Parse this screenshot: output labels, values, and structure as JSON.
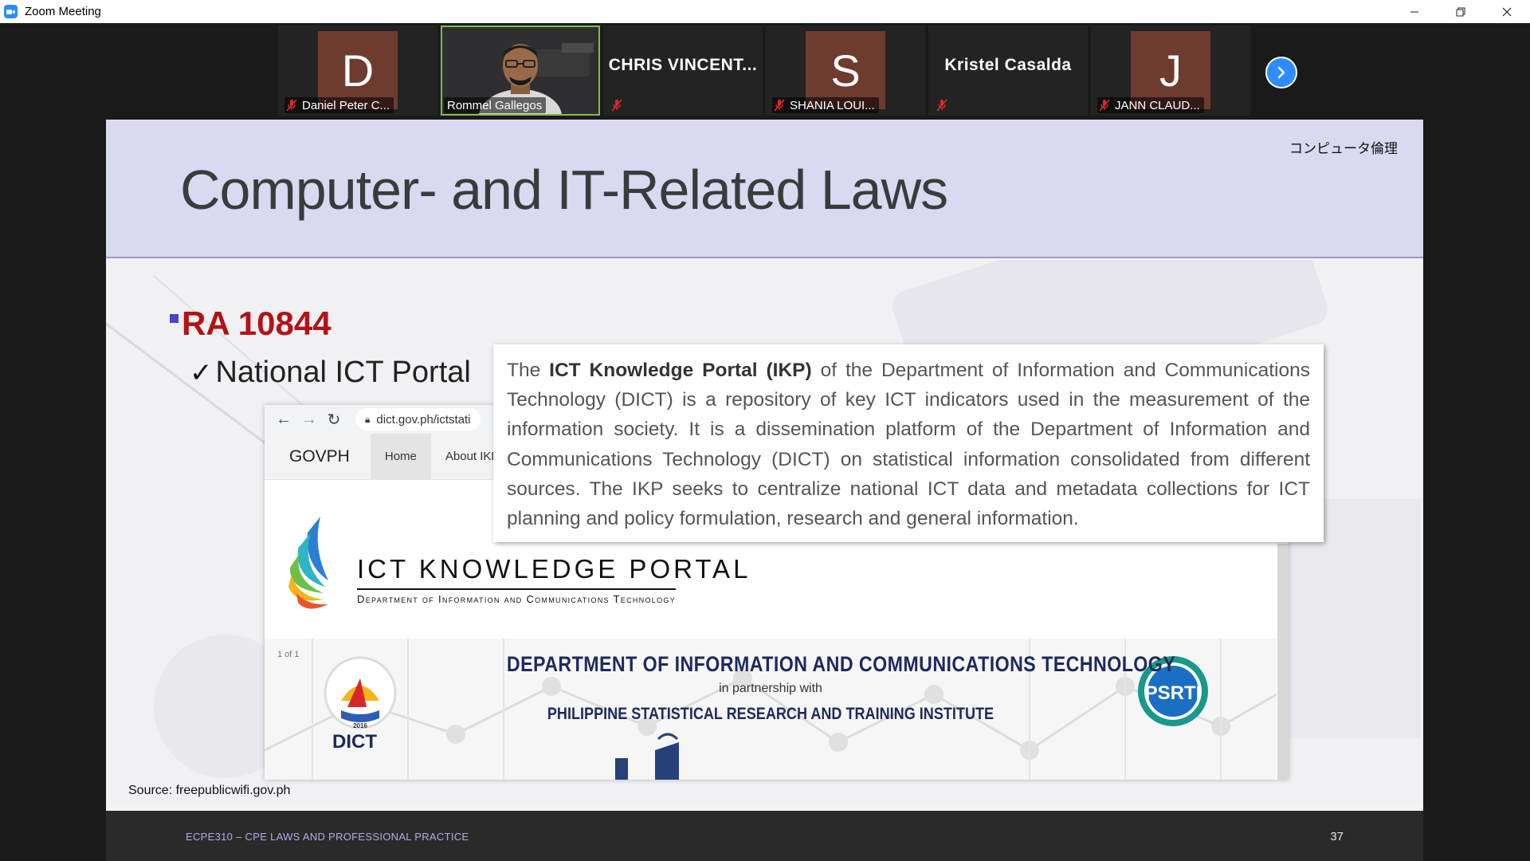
{
  "window": {
    "title": "Zoom Meeting",
    "controls": [
      "minimize",
      "restore",
      "close"
    ]
  },
  "participants": [
    {
      "initial": "D",
      "name": "Daniel Peter C...",
      "muted": true,
      "type": "avatar"
    },
    {
      "initial": "",
      "name": "Rommel Gallegos",
      "muted": false,
      "type": "video",
      "active_speaker": true
    },
    {
      "initial": "",
      "name": "CHRIS  VINCENT...",
      "muted": true,
      "type": "name-only"
    },
    {
      "initial": "S",
      "name": "SHANIA LOUI...",
      "muted": true,
      "type": "avatar"
    },
    {
      "initial": "",
      "name": "Kristel Casalda",
      "muted": true,
      "type": "name-only"
    },
    {
      "initial": "J",
      "name": "JANN CLAUD...",
      "muted": true,
      "type": "avatar"
    }
  ],
  "slide": {
    "jp_label": "コンピュータ倫理",
    "title": "Computer- and IT-Related Laws",
    "bullet": "RA 10844",
    "check_item": "National ICT Portal",
    "source": "Source: freepublicwifi.gov.ph",
    "footer": "ECPE310 – CPE LAWS AND PROFESSIONAL PRACTICE",
    "page_number": "37",
    "callout": {
      "pre": "The ",
      "bold": "ICT Knowledge Portal (IKP)",
      "post": " of the Department of Information and Communications Technology (DICT) is a repository of key ICT indicators used in the measurement of the information society. It is a dissemination platform of the Department of Information and Communications Technology (DICT) on statistical information consolidated from different sources. The IKP seeks to centralize national ICT data and metadata collections for ICT planning and policy formulation, research and general information."
    },
    "website": {
      "url": "dict.gov.ph/ictstati",
      "nav": {
        "brand": "GOVPH",
        "items": [
          "Home",
          "About IKP"
        ]
      },
      "portal_name": "ICT KNOWLEDGE PORTAL",
      "portal_subtitle": "Department of Information and Communications Technology",
      "banner_line1": "DEPARTMENT OF INFORMATION AND COMMUNICATIONS TECHNOLOGY",
      "banner_line2": "in partnership with",
      "banner_line3": "PHILIPPINE STATISTICAL RESEARCH AND TRAINING INSTITUTE",
      "dict_logo_text": "DICT",
      "dict_seal_year": "2016",
      "psrti_logo_text": "PSRTI",
      "pager": "1 of 1"
    }
  },
  "colors": {
    "zoom_blue": "#2d8cff",
    "avatar_brown": "#6e3b2f",
    "slide_header": "#d9d9f1",
    "bullet_red": "#b31217",
    "bullet_square": "#4a45c9",
    "speaker_border": "#7ec043",
    "muted_red": "#e02828"
  }
}
